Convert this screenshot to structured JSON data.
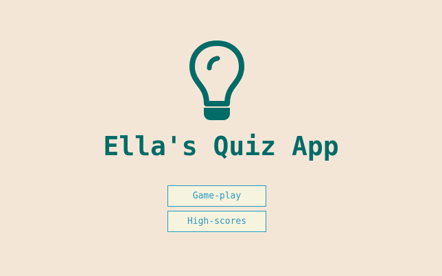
{
  "app": {
    "title": "Ella's Quiz App",
    "logo_icon": "lightbulb-icon"
  },
  "menu": {
    "gameplay_label": "Game-play",
    "highscores_label": "High-scores"
  },
  "colors": {
    "background": "#f4e6d7",
    "brand": "#006b67",
    "button_fill": "#f6f3de",
    "button_accent": "#2a9ac0"
  }
}
